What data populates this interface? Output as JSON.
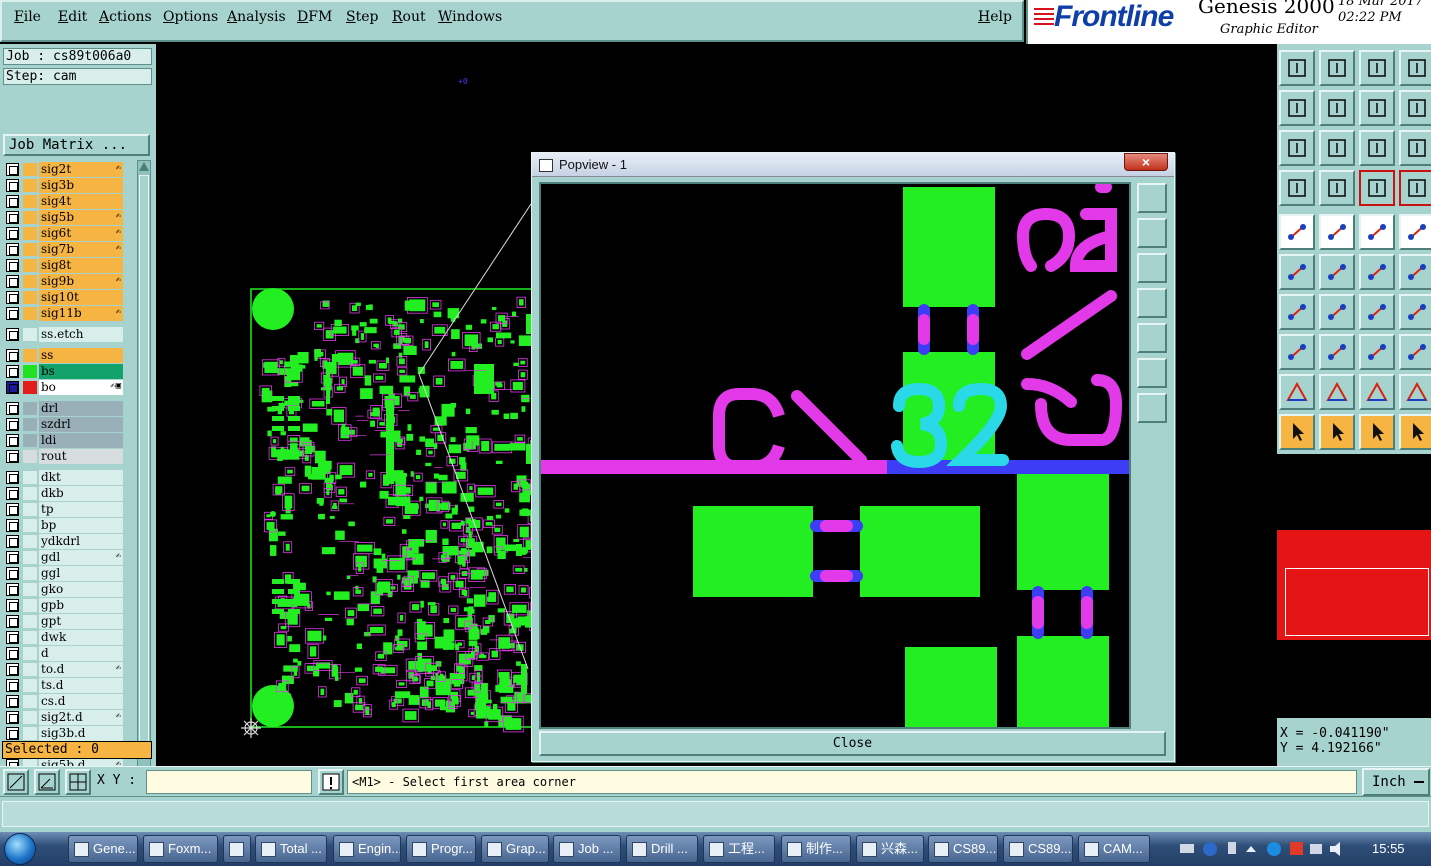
{
  "menu": [
    "File",
    "Edit",
    "Actions",
    "Options",
    "Analysis",
    "DFM",
    "Step",
    "Rout",
    "Windows"
  ],
  "help_label": "Help",
  "brand": {
    "logo": "Frontline",
    "product": "Genesis 2000",
    "subtitle": "Graphic Editor",
    "date": "18 Mar 2017",
    "time": "02:22 PM"
  },
  "job": {
    "job_label": "Job : cs89t006a0",
    "step_label": "Step: cam",
    "matrix_button": "Job Matrix ..."
  },
  "layers": [
    {
      "name": "sig2t",
      "color": "#f6b443",
      "flag": "✍"
    },
    {
      "name": "sig3b",
      "color": "#f6b443",
      "flag": ""
    },
    {
      "name": "sig4t",
      "color": "#f6b443",
      "flag": ""
    },
    {
      "name": "sig5b",
      "color": "#f6b443",
      "flag": "✍"
    },
    {
      "name": "sig6t",
      "color": "#f6b443",
      "flag": "✍"
    },
    {
      "name": "sig7b",
      "color": "#f6b443",
      "flag": "✍"
    },
    {
      "name": "sig8t",
      "color": "#f6b443",
      "flag": ""
    },
    {
      "name": "sig9b",
      "color": "#f6b443",
      "flag": "✍"
    },
    {
      "name": "sig10t",
      "color": "#f6b443",
      "flag": ""
    },
    {
      "name": "sig11b",
      "color": "#f6b443",
      "flag": "✍"
    },
    {
      "name": "ss.etch",
      "color": "#d8eeeb",
      "flag": "",
      "gap": true
    },
    {
      "name": "ss",
      "color": "#f6b443",
      "flag": "",
      "gap": true
    },
    {
      "name": "bs",
      "color": "#12a36d",
      "flag": "",
      "swatch": "#22e022"
    },
    {
      "name": "bo",
      "color": "#ffffff",
      "flag": "✍▣",
      "swatch": "#e21b1b",
      "active": true
    },
    {
      "name": "drl",
      "color": "#9ab0b8",
      "flag": "",
      "gap": true
    },
    {
      "name": "szdrl",
      "color": "#9ab0b8",
      "flag": ""
    },
    {
      "name": "ldi",
      "color": "#9ab0b8",
      "flag": ""
    },
    {
      "name": "rout",
      "color": "#d7dcde",
      "flag": ""
    },
    {
      "name": "dkt",
      "color": "#d8eeeb",
      "flag": "",
      "gap": true
    },
    {
      "name": "dkb",
      "color": "#d8eeeb",
      "flag": ""
    },
    {
      "name": "tp",
      "color": "#d8eeeb",
      "flag": ""
    },
    {
      "name": "bp",
      "color": "#d8eeeb",
      "flag": ""
    },
    {
      "name": "ydkdrl",
      "color": "#d8eeeb",
      "flag": ""
    },
    {
      "name": "gdl",
      "color": "#d8eeeb",
      "flag": "✍"
    },
    {
      "name": "ggl",
      "color": "#d8eeeb",
      "flag": ""
    },
    {
      "name": "gko",
      "color": "#d8eeeb",
      "flag": ""
    },
    {
      "name": "gpb",
      "color": "#d8eeeb",
      "flag": ""
    },
    {
      "name": "gpt",
      "color": "#d8eeeb",
      "flag": ""
    },
    {
      "name": "dwk",
      "color": "#d8eeeb",
      "flag": ""
    },
    {
      "name": "d",
      "color": "#d8eeeb",
      "flag": ""
    },
    {
      "name": "to.d",
      "color": "#d8eeeb",
      "flag": "✍"
    },
    {
      "name": "ts.d",
      "color": "#d8eeeb",
      "flag": ""
    },
    {
      "name": "cs.d",
      "color": "#d8eeeb",
      "flag": ""
    },
    {
      "name": "sig2t.d",
      "color": "#d8eeeb",
      "flag": "✍"
    },
    {
      "name": "sig3b.d",
      "color": "#d8eeeb",
      "flag": ""
    },
    {
      "name": "sig4t.d",
      "color": "#d8eeeb",
      "flag": ""
    },
    {
      "name": "sig5b.d",
      "color": "#d8eeeb",
      "flag": "✍"
    }
  ],
  "selected_label": "Selected : 0",
  "popview": {
    "title": "Popview - 1",
    "close_x": "×",
    "close_button": "Close"
  },
  "coords": {
    "x": "X = -0.041190\"",
    "y": "Y = 4.192166\""
  },
  "command": {
    "xy_label": "X Y :",
    "xy_value": "",
    "prompt": "<M1> - Select first area corner",
    "unit": "Inch"
  },
  "taskbar": {
    "tasks": [
      "Gene...",
      "Foxm...",
      "",
      "Total ...",
      "Engin...",
      "Progr...",
      "Grap...",
      "Job ...",
      "Drill ...",
      "工程...",
      "制作...",
      "兴森...",
      "CS89...",
      "CS89...",
      "CAM..."
    ],
    "clock": "15:55"
  },
  "colors": {
    "panel": "#a6d3cd",
    "pad": "#22ee22",
    "trace": "#e23ae8",
    "via": "#3d3df5",
    "label": "#29d9e8",
    "highlight": "#f6b443"
  }
}
